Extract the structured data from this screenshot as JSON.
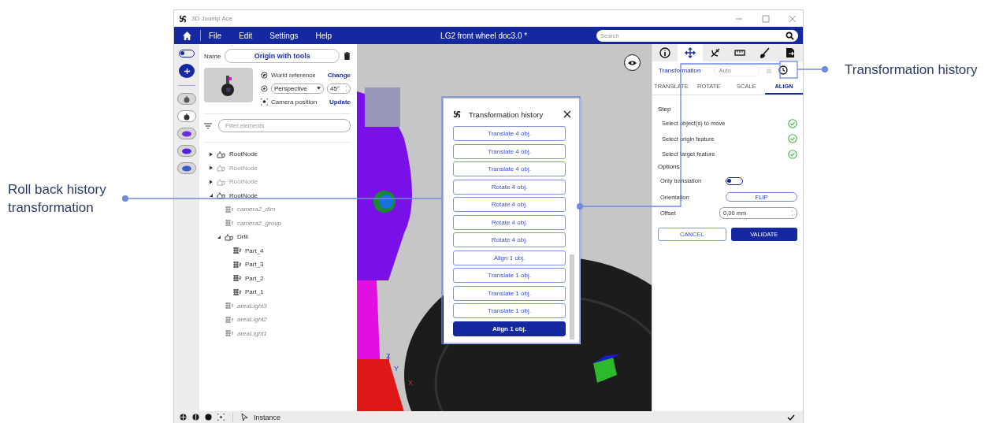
{
  "annotations": {
    "left": "Roll back history transformation",
    "right": "Transformation history"
  },
  "window": {
    "title": "3D Juump Ace"
  },
  "menu": {
    "items": [
      "File",
      "Edit",
      "Settings",
      "Help"
    ],
    "document_title": "LG2 front wheel doc3.0 *",
    "search": {
      "placeholder": "Search"
    }
  },
  "rail": {
    "toggle_on": false,
    "models": [
      {
        "selected": false
      },
      {
        "selected": true
      },
      {
        "selected": false
      },
      {
        "selected": false
      },
      {
        "selected": false
      }
    ]
  },
  "camera": {
    "name_label": "Name",
    "name_value": "Origin with tools",
    "world_reference": "World reference",
    "change": "Change",
    "projection": "Perspective",
    "fov": "45°",
    "camera_position": "Camera position",
    "update": "Update"
  },
  "filter": {
    "placeholder": "Filter elements"
  },
  "tree": [
    {
      "label": "RootNode",
      "kind": "group",
      "disabled": false,
      "expanded": false
    },
    {
      "label": "RootNode",
      "kind": "group",
      "disabled": true,
      "expanded": false
    },
    {
      "label": "RootNode",
      "kind": "group",
      "disabled": true,
      "expanded": false
    },
    {
      "label": "RootNode",
      "kind": "group",
      "disabled": false,
      "expanded": true,
      "children": [
        {
          "label": "camera2_dim",
          "kind": "auxiliary",
          "disabled": false
        },
        {
          "label": "camera2_group",
          "kind": "auxiliary",
          "disabled": false
        },
        {
          "label": "Drill",
          "kind": "group",
          "disabled": false,
          "expanded": true,
          "children": [
            {
              "label": "Part_4",
              "kind": "part",
              "disabled": false
            },
            {
              "label": "Part_3",
              "kind": "part",
              "disabled": false
            },
            {
              "label": "Part_2",
              "kind": "part",
              "disabled": false
            },
            {
              "label": "Part_1",
              "kind": "part",
              "disabled": false
            }
          ]
        },
        {
          "label": "areaLight3",
          "kind": "auxiliary",
          "disabled": false
        },
        {
          "label": "areaLight2",
          "kind": "auxiliary",
          "disabled": false
        },
        {
          "label": "areaLight1",
          "kind": "auxiliary",
          "disabled": false
        }
      ]
    }
  ],
  "viewport": {
    "axes": [
      "Z",
      "Y",
      "X"
    ]
  },
  "history_dialog": {
    "title": "Transformation history",
    "items": [
      {
        "label": "Translate 4 obj.",
        "selected": false
      },
      {
        "label": "Translate 4 obj.",
        "selected": false
      },
      {
        "label": "Translate 4 obj.",
        "selected": false
      },
      {
        "label": "Rotate 4 obj.",
        "selected": false
      },
      {
        "label": "Rotate 4 obj.",
        "selected": false
      },
      {
        "label": "Rotate 4 obj.",
        "selected": false
      },
      {
        "label": "Rotate 4 obj.",
        "selected": false
      },
      {
        "label": "Align 1 obj.",
        "selected": false
      },
      {
        "label": "Translate 1 obj.",
        "selected": false
      },
      {
        "label": "Translate 1 obj.",
        "selected": false
      },
      {
        "label": "Translate 1 obj.",
        "selected": false
      },
      {
        "label": "Align 1 obj.",
        "selected": true
      }
    ]
  },
  "panel": {
    "tabs": [
      {
        "selected": false
      },
      {
        "selected": true
      },
      {
        "selected": false
      },
      {
        "selected": false
      },
      {
        "selected": false
      },
      {
        "selected": false
      }
    ],
    "section_title": "Transformation",
    "mode": {
      "placeholder": "Auto"
    },
    "subtabs": [
      {
        "label": "TRANSLATE",
        "selected": false
      },
      {
        "label": "ROTATE",
        "selected": false
      },
      {
        "label": "SCALE",
        "selected": false
      },
      {
        "label": "ALIGN",
        "selected": true
      }
    ],
    "step_heading": "Step",
    "steps": [
      {
        "label": "Select object(s) to move",
        "done": true
      },
      {
        "label": "Select origin feature",
        "done": true
      },
      {
        "label": "Select target feature",
        "done": true
      }
    ],
    "options_heading": "Options",
    "only_translation": {
      "label": "Only translation",
      "on": false
    },
    "orientation": {
      "label": "Orientation",
      "button": "FLIP"
    },
    "offset": {
      "label": "Offset",
      "value": "0,00 mm"
    },
    "cancel": "CANCEL",
    "validate": "VALIDATE"
  },
  "status_bar": {
    "mode": "Instance"
  }
}
